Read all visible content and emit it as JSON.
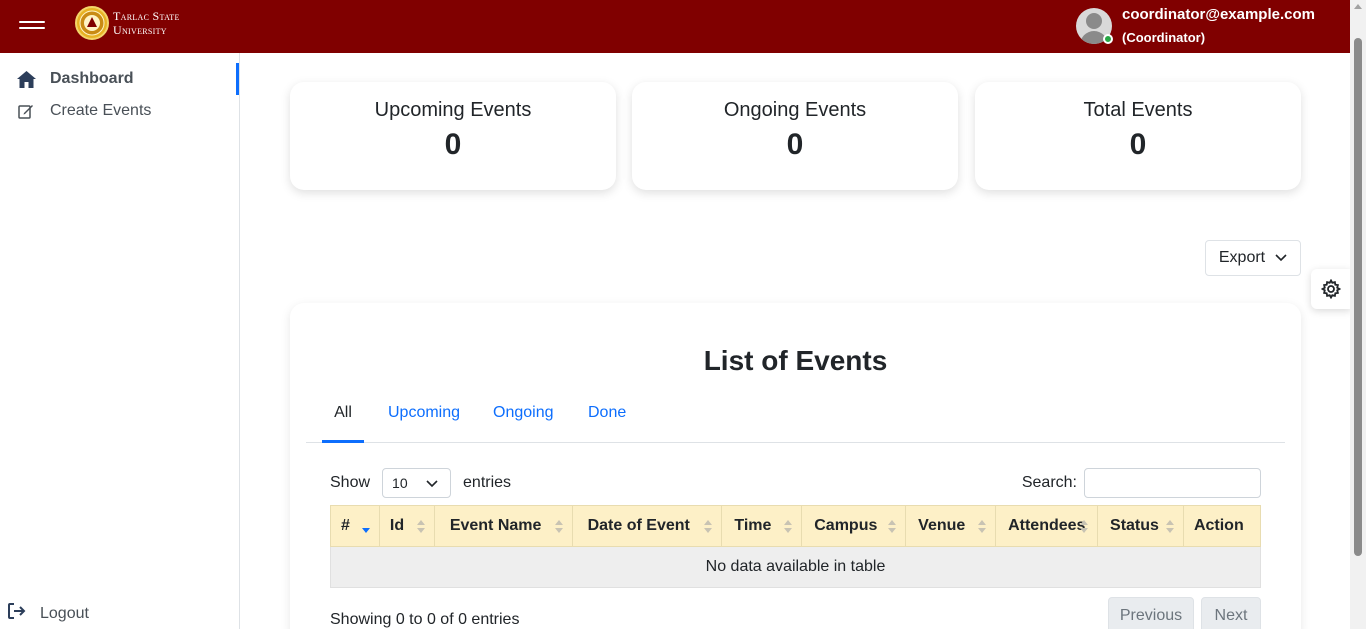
{
  "header": {
    "logo_line1": "Tarlac State",
    "logo_line2": "University",
    "user_email": "coordinator@example.com",
    "user_role": "(Coordinator)",
    "bg_color": "#800000"
  },
  "sidebar": {
    "items": [
      {
        "label": "Dashboard",
        "icon": "home-icon",
        "active": true
      },
      {
        "label": "Create Events",
        "icon": "edit-icon",
        "active": false
      }
    ],
    "logout_label": "Logout"
  },
  "stats": [
    {
      "title": "Upcoming Events",
      "value": "0"
    },
    {
      "title": "Ongoing Events",
      "value": "0"
    },
    {
      "title": "Total Events",
      "value": "0"
    }
  ],
  "export_label": "Export",
  "events": {
    "title": "List of Events",
    "tabs": [
      "All",
      "Upcoming",
      "Ongoing",
      "Done"
    ],
    "active_tab": "All",
    "show_label": "Show",
    "entries_value": "10",
    "entries_label": "entries",
    "search_label": "Search:",
    "columns": [
      "#",
      "Id",
      "Event Name",
      "Date of Event",
      "Time",
      "Campus",
      "Venue",
      "Attendees",
      "Status",
      "Action"
    ],
    "empty_message": "No data available in table",
    "info": "Showing 0 to 0 of 0 entries",
    "prev_label": "Previous",
    "next_label": "Next"
  },
  "accent_color": "#0d6efd",
  "table_header_color": "#fdf0c7"
}
